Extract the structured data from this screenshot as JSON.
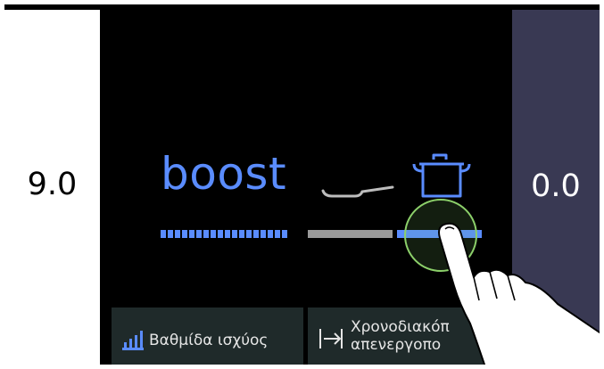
{
  "zones": {
    "left": {
      "value": "9.0"
    },
    "right": {
      "value": "0.0"
    }
  },
  "main": {
    "mode_label": "boost",
    "icons": [
      "frying-pan-icon",
      "pot-icon"
    ],
    "selected_cookware": "pot"
  },
  "buttons": {
    "power_level": {
      "label": "Βαθμίδα ισχύος",
      "icon": "power-level-icon"
    },
    "timer": {
      "label": "Χρονοδιακόπ\nαπενεργοπο",
      "icon": "timer-off-icon"
    }
  },
  "colors": {
    "accent": "#5a8cff",
    "inactive_bar": "#9a9a9a",
    "right_zone": "#393953",
    "button_bg": "#1f2a2a",
    "touch_ring": "#8cd06a"
  }
}
